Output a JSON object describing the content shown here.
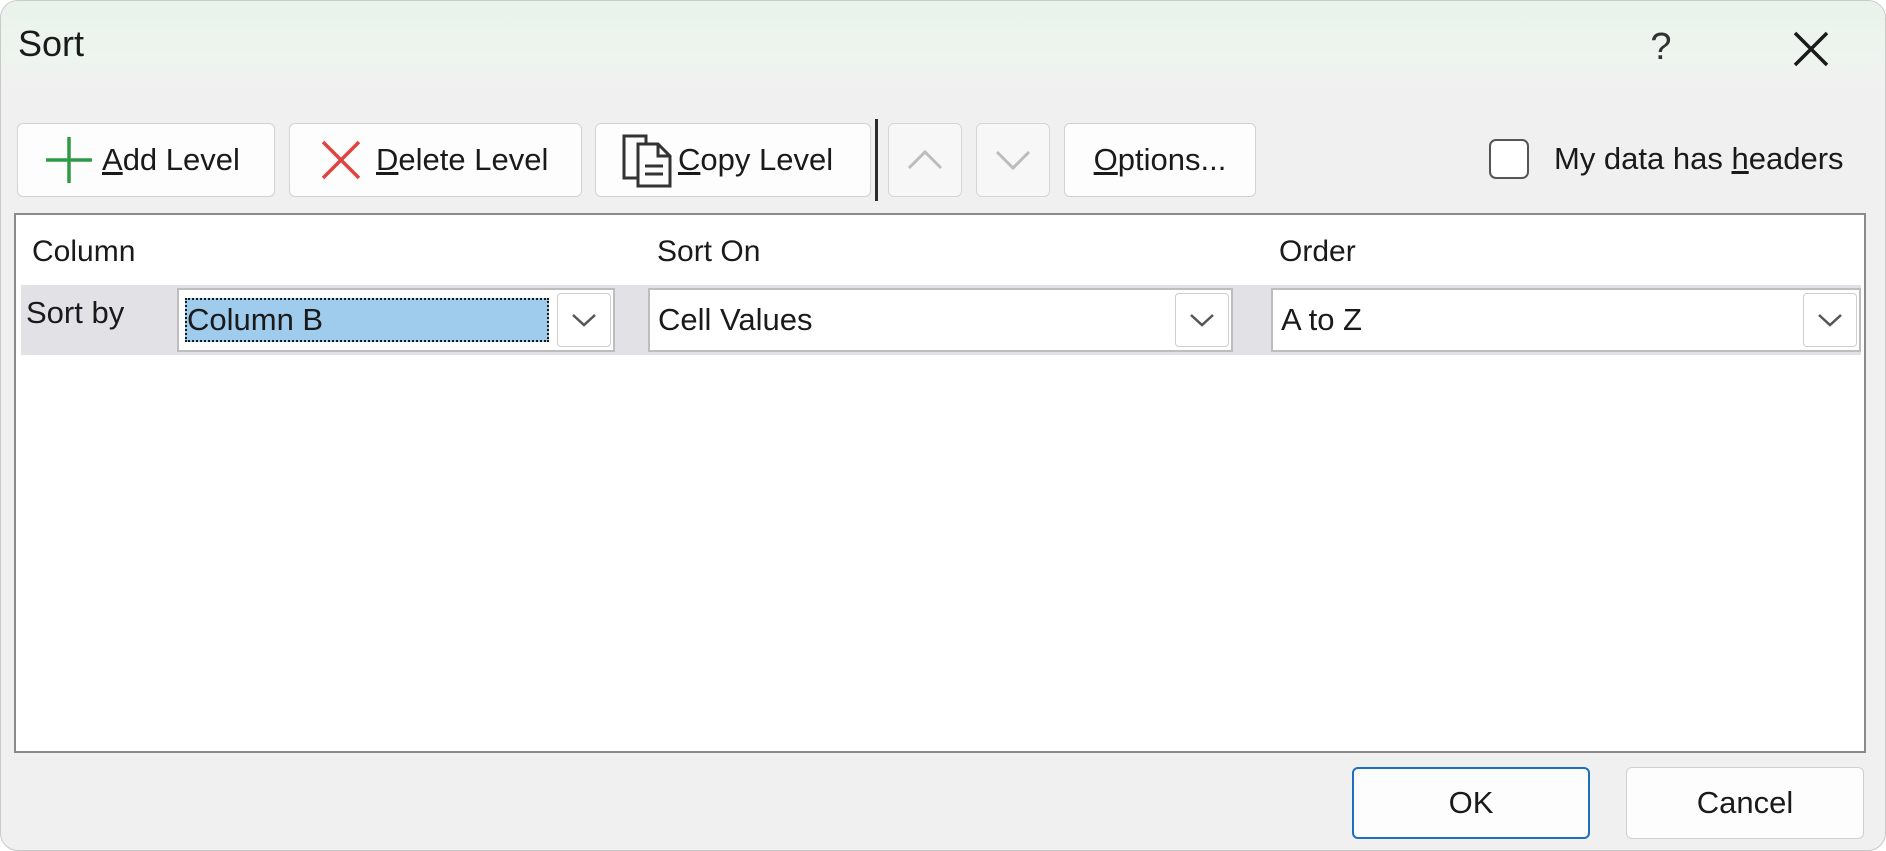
{
  "dialog": {
    "title": "Sort",
    "help_label": "?"
  },
  "toolbar": {
    "add_level": {
      "mnemonic": "A",
      "rest": "dd Level"
    },
    "delete_level": {
      "mnemonic": "D",
      "rest": "elete Level"
    },
    "copy_level": {
      "mnemonic": "C",
      "rest": "opy Level"
    },
    "options": {
      "mnemonic": "O",
      "rest": "ptions..."
    },
    "move_up_icon": "chevron-up-icon",
    "move_down_icon": "chevron-down-icon"
  },
  "headers_checkbox": {
    "label_prefix": "My data has ",
    "mnemonic": "h",
    "label_suffix": "eaders",
    "checked": false
  },
  "grid": {
    "columns": [
      "Column",
      "Sort On",
      "Order"
    ],
    "rows": [
      {
        "label": "Sort by",
        "column": "Column B",
        "sort_on": "Cell Values",
        "order": "A to Z"
      }
    ]
  },
  "footer": {
    "ok_label": "OK",
    "cancel_label": "Cancel"
  },
  "colors": {
    "accent": "#1f6fbf",
    "selection": "#9fcbed",
    "add_icon": "#2e9b47",
    "delete_icon": "#e0443e"
  }
}
